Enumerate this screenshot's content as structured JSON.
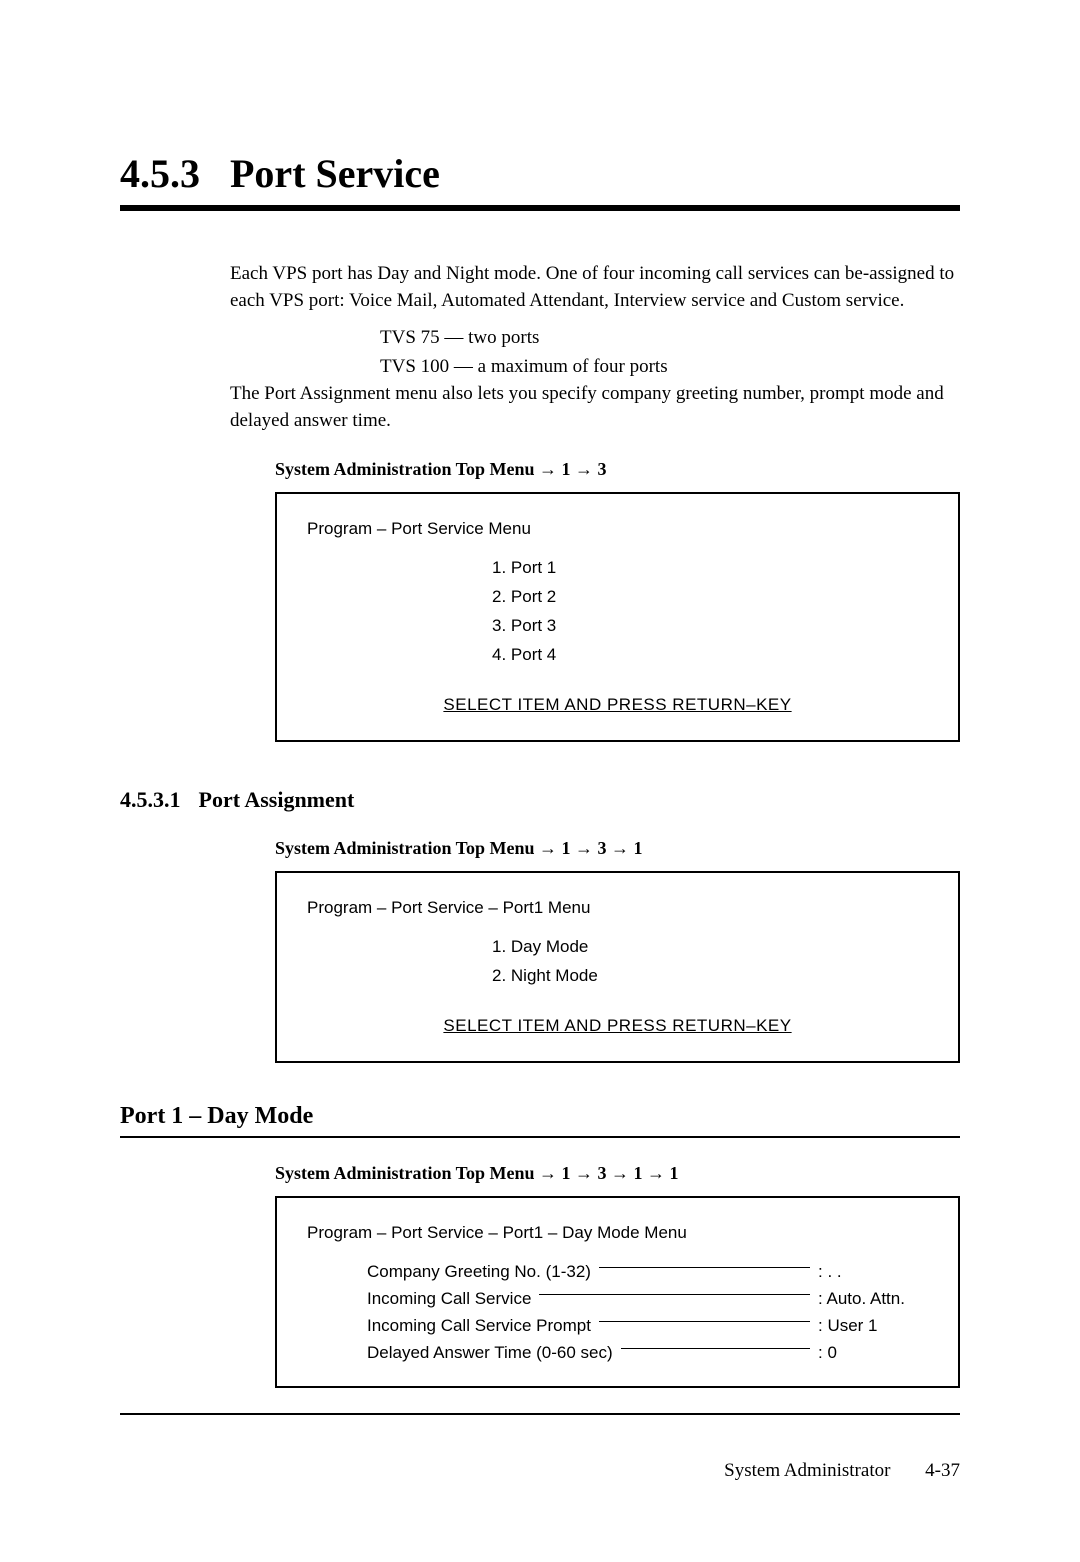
{
  "section": {
    "number": "4.5.3",
    "title": "Port Service"
  },
  "intro": {
    "p1": "Each VPS port has Day and Night mode. One of four incoming call services can be-assigned to each VPS port: Voice Mail, Automated Attendant, Interview service and Custom service.",
    "tvs1": "TVS 75  —  two ports",
    "tvs2": "TVS 100 —  a maximum of four ports",
    "p2": "The Port Assignment menu also lets you specify company greeting number, prompt mode and delayed answer time."
  },
  "menu1": {
    "path": "System Administration Top Menu → 1 → 3",
    "header": "Program – Port Service Menu",
    "items": [
      "1.  Port 1",
      "2.  Port 2",
      "3.  Port 3",
      "4.  Port 4"
    ],
    "footer": "SELECT ITEM AND PRESS RETURN–KEY"
  },
  "subsection": {
    "number": "4.5.3.1",
    "title": "Port Assignment"
  },
  "menu2": {
    "path": "System Administration Top Menu → 1 → 3 → 1",
    "header": "Program – Port Service – Port1 Menu",
    "items": [
      "1.  Day Mode",
      "2.  Night Mode"
    ],
    "footer": "SELECT ITEM AND PRESS RETURN–KEY"
  },
  "port_mode": {
    "title": "Port 1 – Day Mode"
  },
  "menu3": {
    "path": "System Administration Top Menu → 1 → 3 → 1 → 1",
    "header": "Program – Port Service – Port1 – Day Mode Menu",
    "settings": [
      {
        "label": "Company Greeting No. (1-32)",
        "value": ":  . ."
      },
      {
        "label": "Incoming Call Service",
        "value": ":  Auto. Attn."
      },
      {
        "label": "Incoming Call Service Prompt",
        "value": ":  User 1"
      },
      {
        "label": "Delayed Answer Time (0-60 sec)",
        "value": ":  0"
      }
    ]
  },
  "footer": {
    "label": "System Administrator",
    "page": "4-37"
  }
}
